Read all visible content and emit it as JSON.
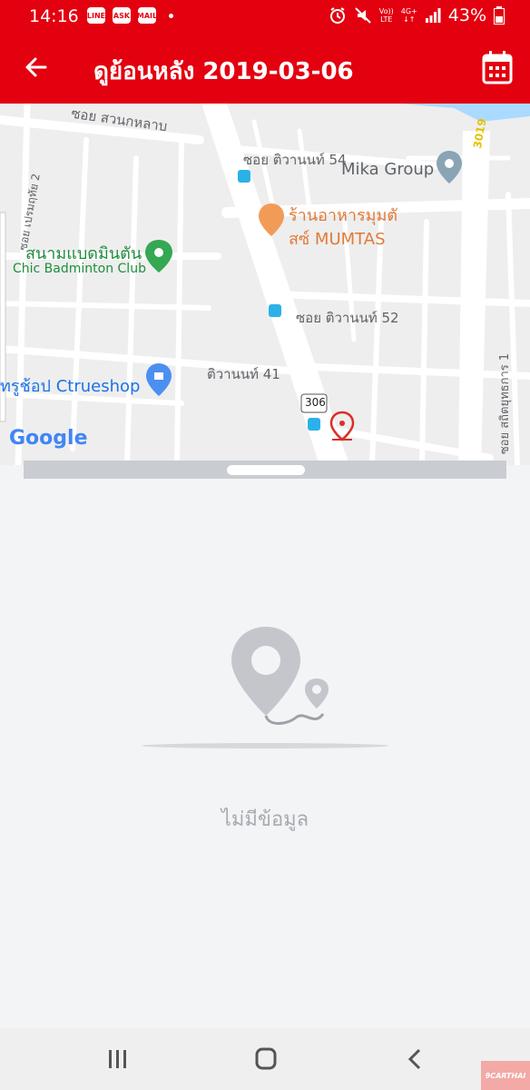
{
  "status_bar": {
    "time": "14:16",
    "left_icons": [
      "LINE",
      "ASK",
      "MAIL"
    ],
    "network_top": "Vo))",
    "network_bottom": "LTE",
    "network2_top": "4G+",
    "network2_bottom": "↓↑",
    "battery": "43%"
  },
  "app_bar": {
    "title": "ดูย้อนหลัง 2019-03-06",
    "back_icon": "arrow-left",
    "calendar_icon": "calendar"
  },
  "map": {
    "labels": {
      "soi_suan": "ซอย สวนกหลาบ",
      "tiwanon54": "ซอย ติวานนท์ 54",
      "mika": "Mika Group",
      "restaurant_th": "ร้านอาหารมุมตั",
      "restaurant_en": "สซ์ MUMTAS",
      "badminton_th": "สนามแบดมินตัน",
      "badminton_en": "Chic Badminton Club",
      "tiwanon52": "ซอย ติวานนท์ 52",
      "ctrue": "ทรูช้อป Ctrueshop",
      "tiwanon41": "ติวานนท์ 41",
      "route306": "306",
      "route3019": "3019",
      "soi_left": "ซอย เปรมฤทัย 2",
      "soi_right": "ซอย สถิตยุทธการ 1",
      "google": "Google"
    },
    "colors": {
      "road": "#ffffff",
      "land": "#eeeeee",
      "water": "#aadaff",
      "pin_red": "#d93025"
    }
  },
  "empty_state": {
    "message": "ไม่มีข้อมูล",
    "icon": "location-route-icon"
  },
  "nav": {
    "recents_icon": "recents",
    "home_icon": "home",
    "back_icon": "back"
  },
  "watermark": "9CARTHAI"
}
